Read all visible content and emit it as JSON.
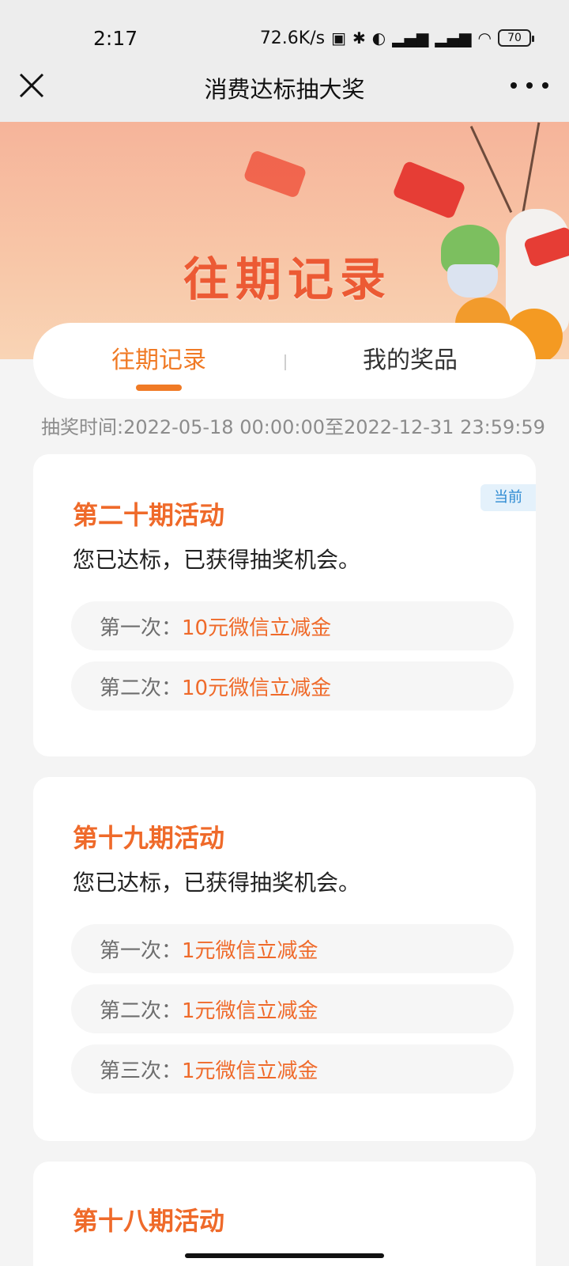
{
  "status_bar": {
    "time": "2:17",
    "network_speed": "72.6K/s",
    "battery": "70",
    "icons": [
      "nfc-icon",
      "bluetooth-icon",
      "toggle-icon",
      "hd-signal-icon",
      "hd-signal-icon",
      "wifi-icon",
      "battery-icon"
    ]
  },
  "nav": {
    "title": "消费达标抽大奖",
    "close_icon": "close-icon",
    "more_icon": "more-icon"
  },
  "banner": {
    "title": "往期记录",
    "accent": "#ec5a34"
  },
  "tabs": [
    {
      "label": "往期记录",
      "active": true
    },
    {
      "label": "我的奖品",
      "active": false
    }
  ],
  "period_text": "抽奖时间:2022-05-18 00:00:00至2022-12-31 23:59:59",
  "cards": [
    {
      "title": "第二十期活动",
      "badge": "当前",
      "desc": "您已达标，已获得抽奖机会。",
      "draws": [
        {
          "label": "第一次：",
          "prize": "10元微信立减金"
        },
        {
          "label": "第二次：",
          "prize": "10元微信立减金"
        }
      ]
    },
    {
      "title": "第十九期活动",
      "desc": "您已达标，已获得抽奖机会。",
      "draws": [
        {
          "label": "第一次：",
          "prize": "1元微信立减金"
        },
        {
          "label": "第二次：",
          "prize": "1元微信立减金"
        },
        {
          "label": "第三次：",
          "prize": "1元微信立减金"
        }
      ]
    },
    {
      "title": "第十八期活动"
    }
  ],
  "colors": {
    "accent_orange": "#ef6a2a",
    "tab_active": "#f07a25",
    "badge_text": "#2c8ad2"
  }
}
